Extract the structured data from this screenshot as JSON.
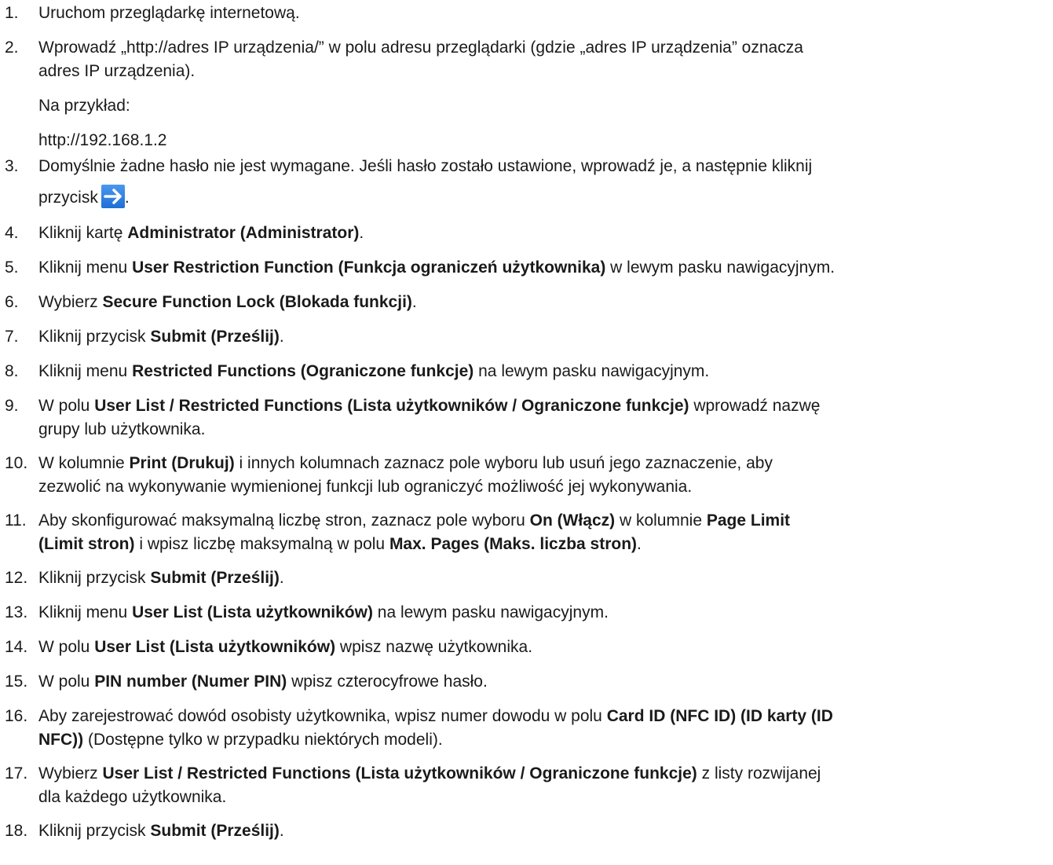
{
  "steps": [
    {
      "num": "1.",
      "parts": [
        [
          "Uruchom przeglądarkę internetową.",
          ""
        ]
      ]
    },
    {
      "num": "2.",
      "lines": [
        [
          [
            "Wprowadź „http://adres IP urządzenia/” w polu adresu przeglądarki (gdzie „adres IP urządzenia” oznacza",
            ""
          ]
        ],
        [
          [
            "adres IP urządzenia).",
            ""
          ]
        ]
      ],
      "sub": [
        "Na przykład:",
        "http://192.168.1.2"
      ]
    },
    {
      "num": "3.",
      "lines": [
        [
          [
            "Domyślnie żadne hasło nie jest wymagane. Jeśli hasło zostało ustawione, wprowadź je, a następnie kliknij",
            ""
          ]
        ],
        [
          [
            "przycisk",
            ""
          ]
        ]
      ],
      "icon": "arrow-right-icon",
      "after_icon": "."
    },
    {
      "num": "4.",
      "parts": [
        [
          "Kliknij kartę ",
          ""
        ],
        [
          "Administrator (Administrator)",
          "b"
        ],
        [
          ".",
          ""
        ]
      ]
    },
    {
      "num": "5.",
      "parts": [
        [
          "Kliknij menu ",
          ""
        ],
        [
          "User Restriction Function (Funkcja ograniczeń użytkownika)",
          "b"
        ],
        [
          " w lewym pasku nawigacyjnym.",
          ""
        ]
      ]
    },
    {
      "num": "6.",
      "parts": [
        [
          "Wybierz ",
          ""
        ],
        [
          "Secure Function Lock (Blokada funkcji)",
          "b"
        ],
        [
          ".",
          ""
        ]
      ]
    },
    {
      "num": "7.",
      "parts": [
        [
          "Kliknij przycisk ",
          ""
        ],
        [
          "Submit (Prześlij)",
          "b"
        ],
        [
          ".",
          ""
        ]
      ]
    },
    {
      "num": "8.",
      "parts": [
        [
          "Kliknij menu ",
          ""
        ],
        [
          "Restricted Functions (Ograniczone funkcje)",
          "b"
        ],
        [
          " na lewym pasku nawigacyjnym.",
          ""
        ]
      ]
    },
    {
      "num": "9.",
      "lines": [
        [
          [
            "W polu ",
            ""
          ],
          [
            "User List / Restricted Functions (Lista użytkowników / Ograniczone funkcje)",
            "b"
          ],
          [
            " wprowadź nazwę",
            ""
          ]
        ],
        [
          [
            "grupy lub użytkownika.",
            ""
          ]
        ]
      ]
    },
    {
      "num": "10.",
      "lines": [
        [
          [
            "W kolumnie ",
            ""
          ],
          [
            "Print (Drukuj)",
            "b"
          ],
          [
            " i innych kolumnach zaznacz pole wyboru lub usuń jego zaznaczenie, aby",
            ""
          ]
        ],
        [
          [
            "zezwolić na wykonywanie wymienionej funkcji lub ograniczyć możliwość jej wykonywania.",
            ""
          ]
        ]
      ]
    },
    {
      "num": "11.",
      "lines": [
        [
          [
            "Aby skonfigurować maksymalną liczbę stron, zaznacz pole wyboru ",
            ""
          ],
          [
            "On (Włącz)",
            "b"
          ],
          [
            " w kolumnie ",
            ""
          ],
          [
            "Page Limit",
            "b"
          ]
        ],
        [
          [
            "(Limit stron)",
            "b"
          ],
          [
            " i wpisz liczbę maksymalną w polu ",
            ""
          ],
          [
            "Max. Pages (Maks. liczba stron)",
            "b"
          ],
          [
            ".",
            ""
          ]
        ]
      ]
    },
    {
      "num": "12.",
      "parts": [
        [
          "Kliknij przycisk ",
          ""
        ],
        [
          "Submit (Prześlij)",
          "b"
        ],
        [
          ".",
          ""
        ]
      ]
    },
    {
      "num": "13.",
      "parts": [
        [
          "Kliknij menu ",
          ""
        ],
        [
          "User List (Lista użytkowników)",
          "b"
        ],
        [
          " na lewym pasku nawigacyjnym.",
          ""
        ]
      ]
    },
    {
      "num": "14.",
      "parts": [
        [
          "W polu ",
          ""
        ],
        [
          "User List (Lista użytkowników)",
          "b"
        ],
        [
          " wpisz nazwę użytkownika.",
          ""
        ]
      ]
    },
    {
      "num": "15.",
      "parts": [
        [
          "W polu ",
          ""
        ],
        [
          "PIN number (Numer PIN)",
          "b"
        ],
        [
          " wpisz czterocyfrowe hasło.",
          ""
        ]
      ]
    },
    {
      "num": "16.",
      "lines": [
        [
          [
            "Aby zarejestrować dowód osobisty użytkownika, wpisz numer dowodu w polu ",
            ""
          ],
          [
            "Card ID (NFC ID) (ID karty (ID",
            "b"
          ]
        ],
        [
          [
            "NFC))",
            "b"
          ],
          [
            " (Dostępne tylko w przypadku niektórych modeli).",
            ""
          ]
        ]
      ]
    },
    {
      "num": "17.",
      "lines": [
        [
          [
            "Wybierz ",
            ""
          ],
          [
            "User List / Restricted Functions (Lista użytkowników / Ograniczone funkcje)",
            "b"
          ],
          [
            " z listy rozwijanej",
            ""
          ]
        ],
        [
          [
            "dla każdego użytkownika.",
            ""
          ]
        ]
      ]
    },
    {
      "num": "18.",
      "parts": [
        [
          "Kliknij przycisk ",
          ""
        ],
        [
          "Submit (Prześlij)",
          "b"
        ],
        [
          ".",
          ""
        ]
      ]
    }
  ],
  "colors": {
    "text": "#1a1a1a",
    "icon_bg": "#1f6fd6",
    "icon_fg": "#ffffff"
  }
}
